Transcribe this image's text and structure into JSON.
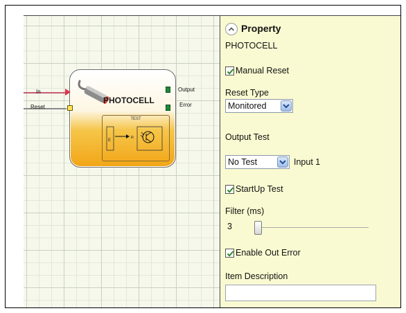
{
  "block": {
    "title": "PHOTOCELL",
    "test_label": "TEST",
    "input_in": "In",
    "input_reset": "Reset",
    "output_label": "Output",
    "error_label": "Error",
    "diagram_e": "E",
    "diagram_r": "R"
  },
  "property": {
    "title": "Property",
    "component_name": "PHOTOCELL",
    "manual_reset": {
      "label": "Manual Reset",
      "checked": true
    },
    "reset_type": {
      "label": "Reset Type",
      "value": "Monitored"
    },
    "output_test": {
      "label": "Output Test",
      "value": "No Test",
      "input_label": "Input 1"
    },
    "startup_test": {
      "label": "StartUp Test",
      "checked": true
    },
    "filter": {
      "label": "Filter (ms)",
      "value": "3"
    },
    "enable_out_error": {
      "label": "Enable Out Error",
      "checked": true
    },
    "item_description": {
      "label": "Item Description",
      "value": ""
    }
  },
  "colors": {
    "panel_bg": "#fafad2",
    "block_gradient_bottom": "#f2a516",
    "input_arrow": "#d9364c",
    "reset_port": "#ffe35a",
    "output_port": "#1e8a3a",
    "checkmark": "#2a8a2a",
    "dropdown_button": "#9fbee6"
  },
  "icons": {
    "collapse": "chevron-up-circle-icon",
    "sensor": "photocell-sensor-icon",
    "checkbox": "check-icon",
    "dropdown": "chevron-down-icon"
  }
}
